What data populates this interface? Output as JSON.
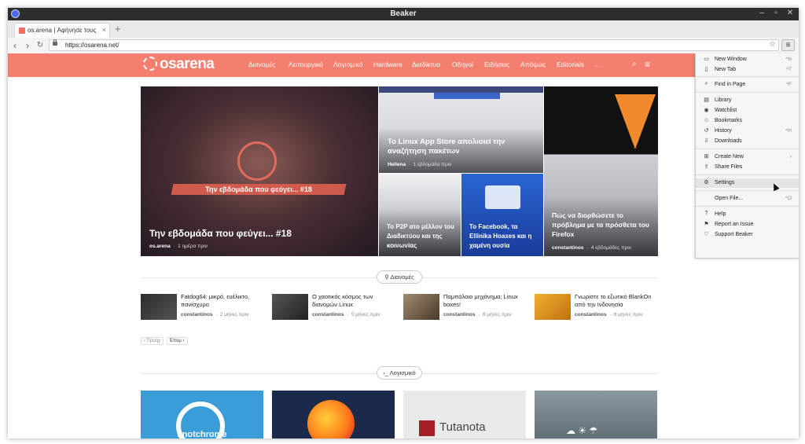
{
  "window": {
    "title": "Beaker"
  },
  "tab": {
    "title": "os.arena | Αφήνησε τους κανόνες..."
  },
  "address": {
    "url": "https://osarena.net/"
  },
  "site": {
    "logo": "osarena",
    "nav": [
      "Διανομές",
      "Λειτουργικά",
      "Λογισμικό",
      "Hardware",
      "Διαδίκτυο",
      "Οδηγοί",
      "Ειδήσεις",
      "Απόψεις",
      "Editorials",
      "..."
    ]
  },
  "featured": {
    "main": {
      "title": "Την εβδομάδα που φεύγει... #18",
      "banner": "Την εβδομάδα που φεύγει... #18",
      "author": "os.arena",
      "time": "1 ημέρα πριν"
    },
    "top_middle": {
      "title": "Το Linux App Store απολιοιεί την αναζήτηση πακέτων",
      "author": "Hellena",
      "time": "1 εβδομάδα πριν"
    },
    "bottom_left": {
      "title": "Το P2P ατο μέλλον του Διαδικτύου και της κοινωνίας"
    },
    "bottom_mid": {
      "title": "Το Facebook, τα Ellinika Hoaxes και η χαμένη ουσία"
    },
    "right": {
      "title": "Πώς να διορθώσετε το πρόβλημα με τα πρόσθετα του Firefox",
      "author": "constantinos",
      "time": "4 εβδομάδες πριν"
    }
  },
  "sections": {
    "distros": {
      "label": "Διανομές",
      "articles": [
        {
          "title": "Fatdog64: μικρό, ευέλικτο, πανίσχυρο",
          "author": "constantinos",
          "time": "2 μήνες πριν"
        },
        {
          "title": "Ο χαοτικός κόσμος των διανομών Linux",
          "author": "constantinos",
          "time": "5 μήνες πριν"
        },
        {
          "title": "Παμπάλαιο μηχάνημα; Linux boxes!",
          "author": "constantinos",
          "time": "6 μήνες πριν"
        },
        {
          "title": "Γνωρίστε το εξωτικό BlankOn από την Ινδονησία",
          "author": "constantinos",
          "time": "6 μήνες πριν"
        }
      ],
      "prev": "‹ Προηγ",
      "next": "Επομ ›"
    },
    "software": {
      "label": "Λογισμικό",
      "thumbs": [
        "#notchrome",
        "",
        "Tutanota",
        ""
      ]
    }
  },
  "menu": {
    "items": [
      {
        "icon": "▭",
        "label": "New Window",
        "shortcut": "^N"
      },
      {
        "icon": "▯",
        "label": "New Tab",
        "shortcut": "^T"
      },
      {
        "icon": "⌕",
        "label": "Find in Page",
        "shortcut": "^F"
      },
      {
        "icon": "▤",
        "label": "Library",
        "shortcut": ""
      },
      {
        "icon": "◉",
        "label": "Watchlist",
        "shortcut": ""
      },
      {
        "icon": "☆",
        "label": "Bookmarks",
        "shortcut": ""
      },
      {
        "icon": "↺",
        "label": "History",
        "shortcut": "^H"
      },
      {
        "icon": "⇩",
        "label": "Downloads",
        "shortcut": ""
      },
      {
        "icon": "⊞",
        "label": "Create New",
        "shortcut": "›"
      },
      {
        "icon": "⇪",
        "label": "Share Files",
        "shortcut": ""
      },
      {
        "icon": "⚙",
        "label": "Settings",
        "shortcut": ""
      },
      {
        "icon": "",
        "label": "Open File...",
        "shortcut": "^O"
      },
      {
        "icon": "?",
        "label": "Help",
        "shortcut": ""
      },
      {
        "icon": "⚑",
        "label": "Report an Issue",
        "shortcut": ""
      },
      {
        "icon": "♡",
        "label": "Support Beaker",
        "shortcut": ""
      }
    ]
  },
  "colors": {
    "brand": "#f57f6f",
    "titlebar": "#2d2d2d"
  }
}
